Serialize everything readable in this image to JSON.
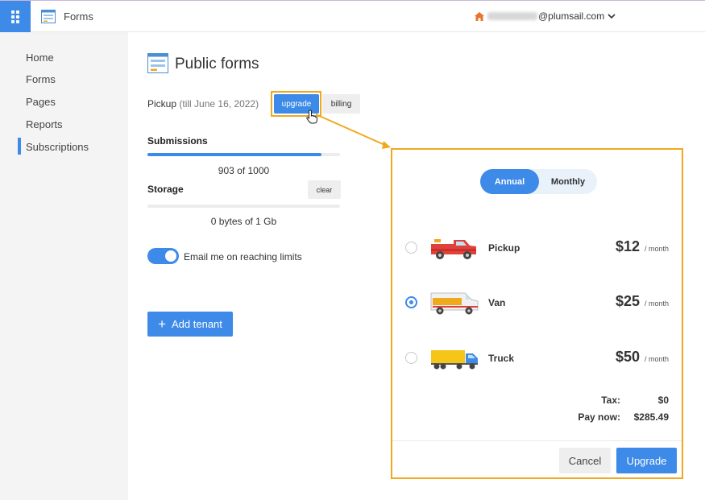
{
  "app": {
    "title": "Forms"
  },
  "account": {
    "email_suffix": "@plumsail.com"
  },
  "sidebar": {
    "items": [
      {
        "label": "Home"
      },
      {
        "label": "Forms"
      },
      {
        "label": "Pages"
      },
      {
        "label": "Reports"
      },
      {
        "label": "Subscriptions",
        "active": true
      }
    ]
  },
  "main": {
    "title": "Public forms",
    "plan": {
      "name": "Pickup",
      "expiry": "(till June 16, 2022)"
    },
    "upgrade_label": "upgrade",
    "billing_label": "billing",
    "submissions": {
      "label": "Submissions",
      "used": 903,
      "limit": 1000,
      "text": "903 of 1000"
    },
    "storage": {
      "label": "Storage",
      "text": "0 bytes of 1 Gb",
      "clear_label": "clear"
    },
    "email_toggle": {
      "label": "Email me on reaching limits",
      "on": true
    },
    "add_tenant_label": "Add tenant"
  },
  "modal": {
    "period": {
      "annual": "Annual",
      "monthly": "Monthly",
      "selected": "Annual"
    },
    "plans": [
      {
        "name": "Pickup",
        "price": "$12",
        "per": "/ month",
        "selected": false
      },
      {
        "name": "Van",
        "price": "$25",
        "per": "/ month",
        "selected": true
      },
      {
        "name": "Truck",
        "price": "$50",
        "per": "/ month",
        "selected": false
      }
    ],
    "tax": {
      "label": "Tax:",
      "value": "$0"
    },
    "pay_now": {
      "label": "Pay now:",
      "value": "$285.49"
    },
    "cancel_label": "Cancel",
    "upgrade_label": "Upgrade"
  },
  "colors": {
    "accent": "#3d8ae8",
    "highlight": "#f0a91c",
    "home_icon": "#e8742c"
  }
}
